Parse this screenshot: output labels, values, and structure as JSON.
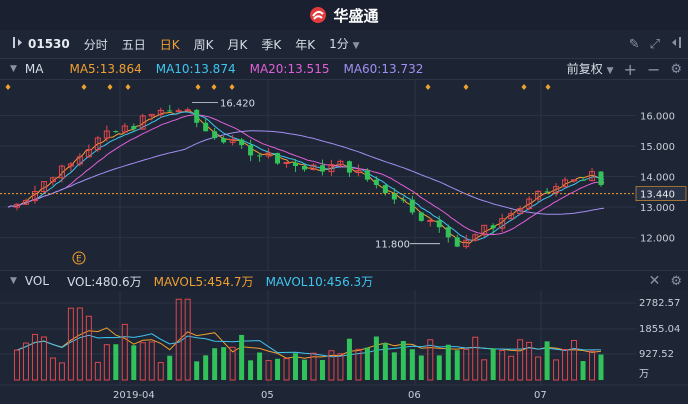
{
  "app": {
    "brand": "华盛通"
  },
  "toolbar": {
    "code": "01530",
    "periods": [
      "分时",
      "五日",
      "日K",
      "周K",
      "月K",
      "季K",
      "年K",
      "1分"
    ],
    "active": "日K"
  },
  "ma_bar": {
    "label": "MA",
    "items": [
      {
        "text": "MA5:13.864",
        "color": "#f0a030"
      },
      {
        "text": "MA10:13.874",
        "color": "#3ec6f0"
      },
      {
        "text": "MA20:13.515",
        "color": "#e060d8"
      },
      {
        "text": "MA60:13.732",
        "color": "#a290f0"
      }
    ],
    "adjust": "前复权"
  },
  "vol_bar": {
    "label": "VOL",
    "items": [
      {
        "text": "VOL:480.6万",
        "color": "#d7dce6"
      },
      {
        "text": "MAVOL5:454.7万",
        "color": "#f0a030"
      },
      {
        "text": "MAVOL10:456.3万",
        "color": "#3ec6f0"
      }
    ]
  },
  "price_axis": {
    "ticks": [
      "16.000",
      "15.000",
      "14.000",
      "13.000",
      "12.000"
    ],
    "current": "13.440"
  },
  "vol_axis": {
    "ticks": [
      "2782.57",
      "1855.04",
      "927.52"
    ],
    "unit": "万"
  },
  "date_axis": {
    "ticks": [
      "2019-04",
      "05",
      "06",
      "07"
    ]
  },
  "annotations": {
    "high": "16.420",
    "low": "11.800",
    "event": "E"
  },
  "colors": {
    "up": "#e0474c",
    "down": "#32c25a",
    "bg": "#1e2535"
  },
  "chart_data": {
    "type": "candlestick",
    "ylim": [
      11.2,
      16.9
    ],
    "high_label": 16.42,
    "low_label": 11.8,
    "last_price": 13.44,
    "x_ticks": [
      "2019-04",
      "05",
      "06",
      "07"
    ]
  }
}
